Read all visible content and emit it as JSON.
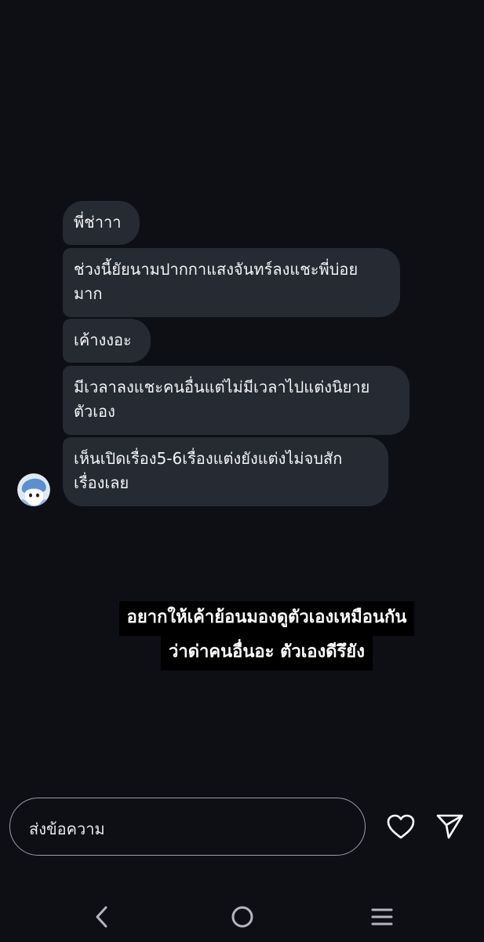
{
  "messages": [
    {
      "text": "พี่ช่าาา"
    },
    {
      "text": "ช่วงนี้ยัยนามปากกาแสงจันทร์ลงแชะพี่บ่อยมาก",
      "line1": "ช่วงนี้ยัยนามปากกาแสงจันทร์ลงแชะพี่บ่อย",
      "line2": "มาก"
    },
    {
      "text": "เค้างงอะ"
    },
    {
      "text": "มีเวลาลงแชะคนอื่นแต่ไม่มีเวลาไปแต่งนิยายตัวเอง",
      "line1": "มีเวลาลงแชะคนอื่นแต่ไม่มีเวลาไปแต่งนิยาย",
      "line2": "ตัวเอง"
    },
    {
      "text": "เห็นเปิดเรื่อง5-6เรื่องแต่งยังแต่งไม่จบสักเรื่องเลย",
      "line1": "เห็นเปิดเรื่อง5-6เรื่องแต่งยังแต่งไม่จบสัก",
      "line2": "เรื่องเลย"
    }
  ],
  "caption": {
    "line1": "อยากให้เค้าย้อนมองดูตัวเองเหมือนกัน",
    "line2": "ว่าด่าคนอื่นอะ ตัวเองดีรึยัง"
  },
  "composer": {
    "placeholder": "ส่งข้อความ"
  },
  "icons": {
    "heart": "heart-icon",
    "send": "send-icon",
    "back": "back-chevron-icon",
    "home": "home-circle-icon",
    "menu": "menu-lines-icon"
  },
  "colors": {
    "background": "#0d0f15",
    "bubble": "#262a32",
    "text": "#f3f4f6"
  }
}
